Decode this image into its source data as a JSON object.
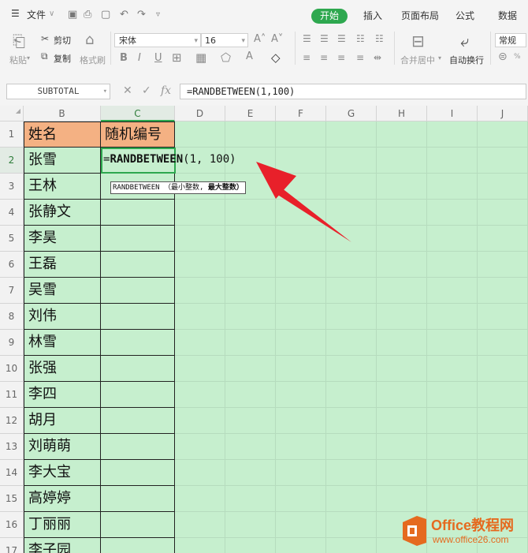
{
  "menu": {
    "file_label": "文件",
    "tabs": [
      "开始",
      "插入",
      "页面布局",
      "公式",
      "数据"
    ],
    "active_tab": "开始"
  },
  "ribbon": {
    "paste": "粘贴",
    "cut": "剪切",
    "copy": "复制",
    "format_painter": "格式刷",
    "font_name": "宋体",
    "font_size": "16",
    "merge_center": "合并居中",
    "wrap_text": "自动换行",
    "number_format": "常规"
  },
  "formula_bar": {
    "name_box": "SUBTOTAL",
    "fx_label": "fx",
    "formula": "=RANDBETWEEN(1,100)"
  },
  "columns": [
    "B",
    "C",
    "D",
    "E",
    "F",
    "G",
    "H",
    "I",
    "J"
  ],
  "rows": [
    "1",
    "2",
    "3",
    "4",
    "5",
    "6",
    "7",
    "8",
    "9",
    "10",
    "11",
    "12",
    "13",
    "14",
    "15",
    "16",
    "17"
  ],
  "table": {
    "header_name": "姓名",
    "header_id": "随机编号",
    "names": [
      "张雪",
      "王林",
      "张静文",
      "李昊",
      "王磊",
      "吴雪",
      "刘伟",
      "林雪",
      "张强",
      "李四",
      "胡月",
      "刘萌萌",
      "李大宝",
      "高婷婷",
      "丁丽丽",
      "李子园"
    ]
  },
  "editing": {
    "prefix": "=",
    "func": "RANDBETWEEN",
    "args": "(1, 100)",
    "tooltip_func": "RANDBETWEEN",
    "tooltip_args_plain": "（最小整数,",
    "tooltip_args_bold": "最大整数）"
  },
  "watermark": {
    "title": "Office教程网",
    "url": "www.office26.com"
  },
  "colors": {
    "accent": "#2ea84f",
    "sheet_fill": "#c6efce",
    "header_fill": "#f4b183",
    "arrow": "#e8202a"
  }
}
